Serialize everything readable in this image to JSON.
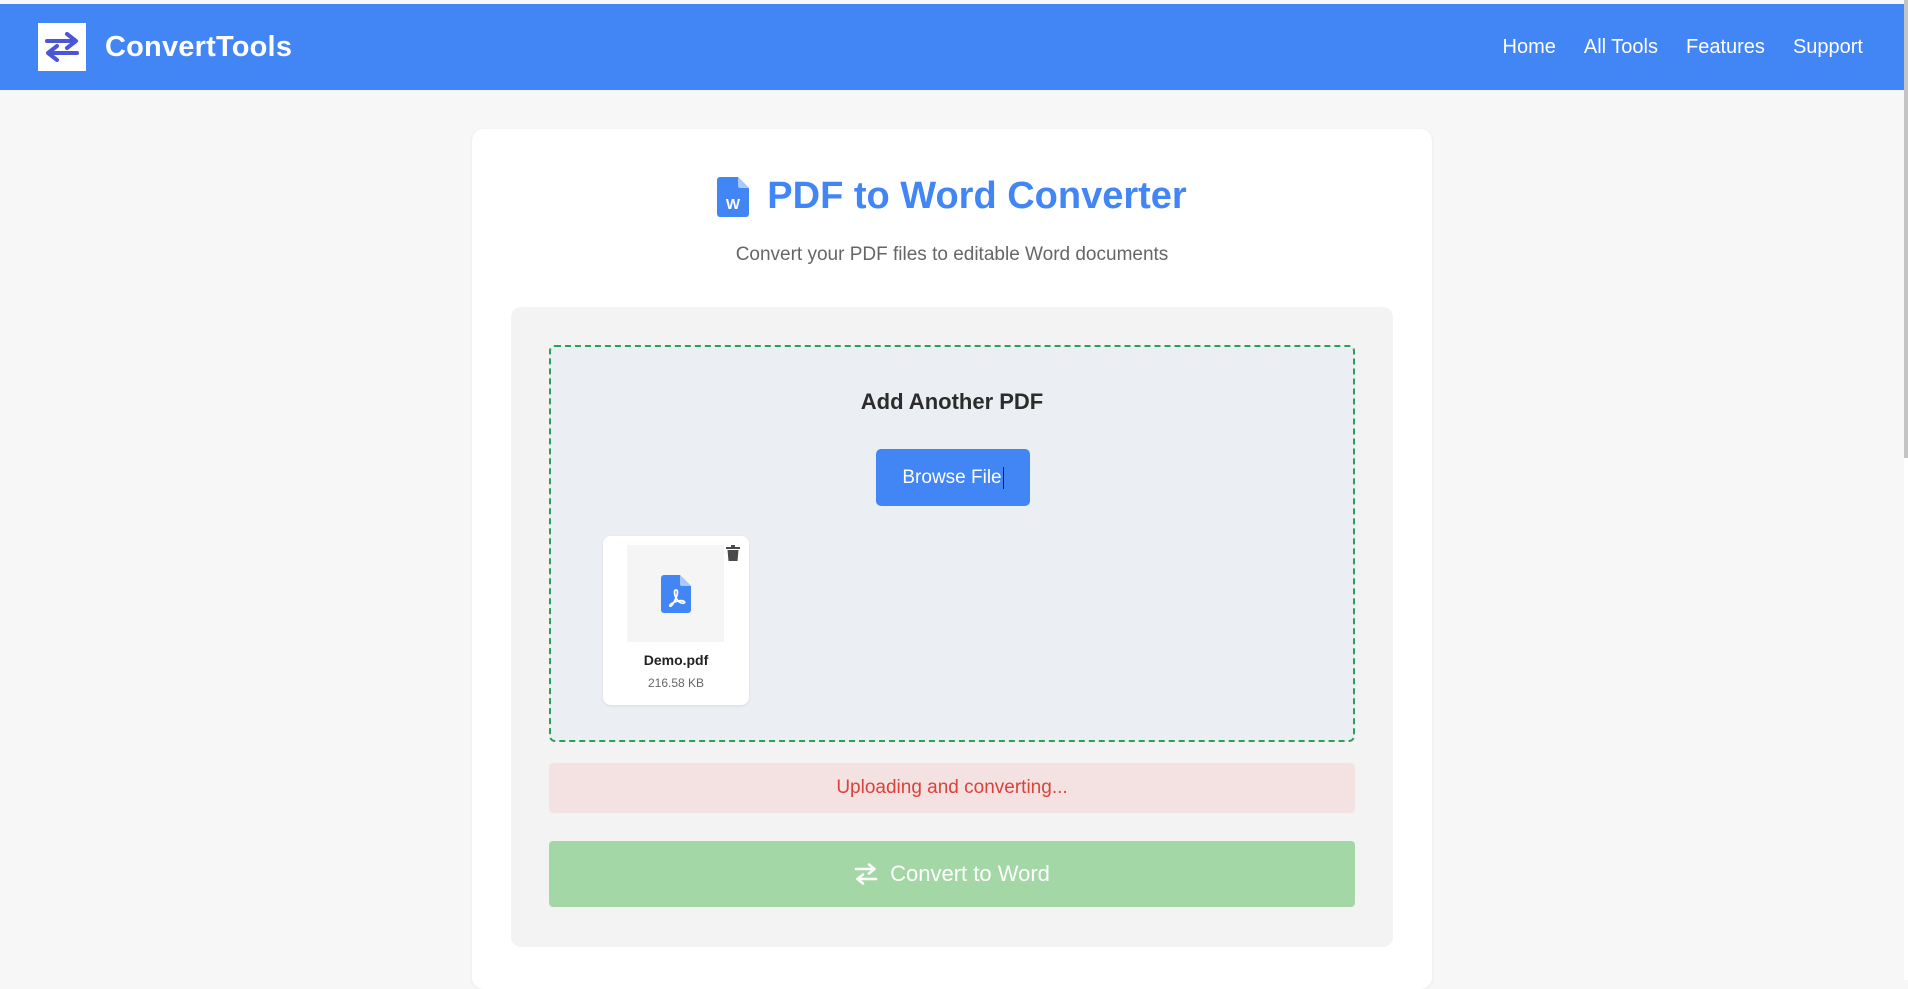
{
  "header": {
    "brand": "ConvertTools",
    "logo_icon": "swap-arrows-icon",
    "nav": [
      {
        "label": "Home"
      },
      {
        "label": "All Tools"
      },
      {
        "label": "Features"
      },
      {
        "label": "Support"
      }
    ]
  },
  "main": {
    "title_icon": "word-file-icon",
    "title": "PDF to Word Converter",
    "subtitle": "Convert your PDF files to editable Word documents"
  },
  "dropzone": {
    "title": "Add Another PDF",
    "browse_label": "Browse File"
  },
  "files": [
    {
      "name": "Demo.pdf",
      "size": "216.58 KB",
      "icon": "pdf-file-icon",
      "delete_icon": "trash-icon"
    }
  ],
  "status": {
    "text": "Uploading and converting..."
  },
  "convert": {
    "label": "Convert to Word",
    "icon": "swap-arrows-icon"
  },
  "colors": {
    "primary": "#4285f4",
    "dropzone_border": "#2aa15a",
    "status_bg": "#f4e2e2",
    "status_text": "#d9433a",
    "convert_disabled": "#a4d7a6"
  }
}
